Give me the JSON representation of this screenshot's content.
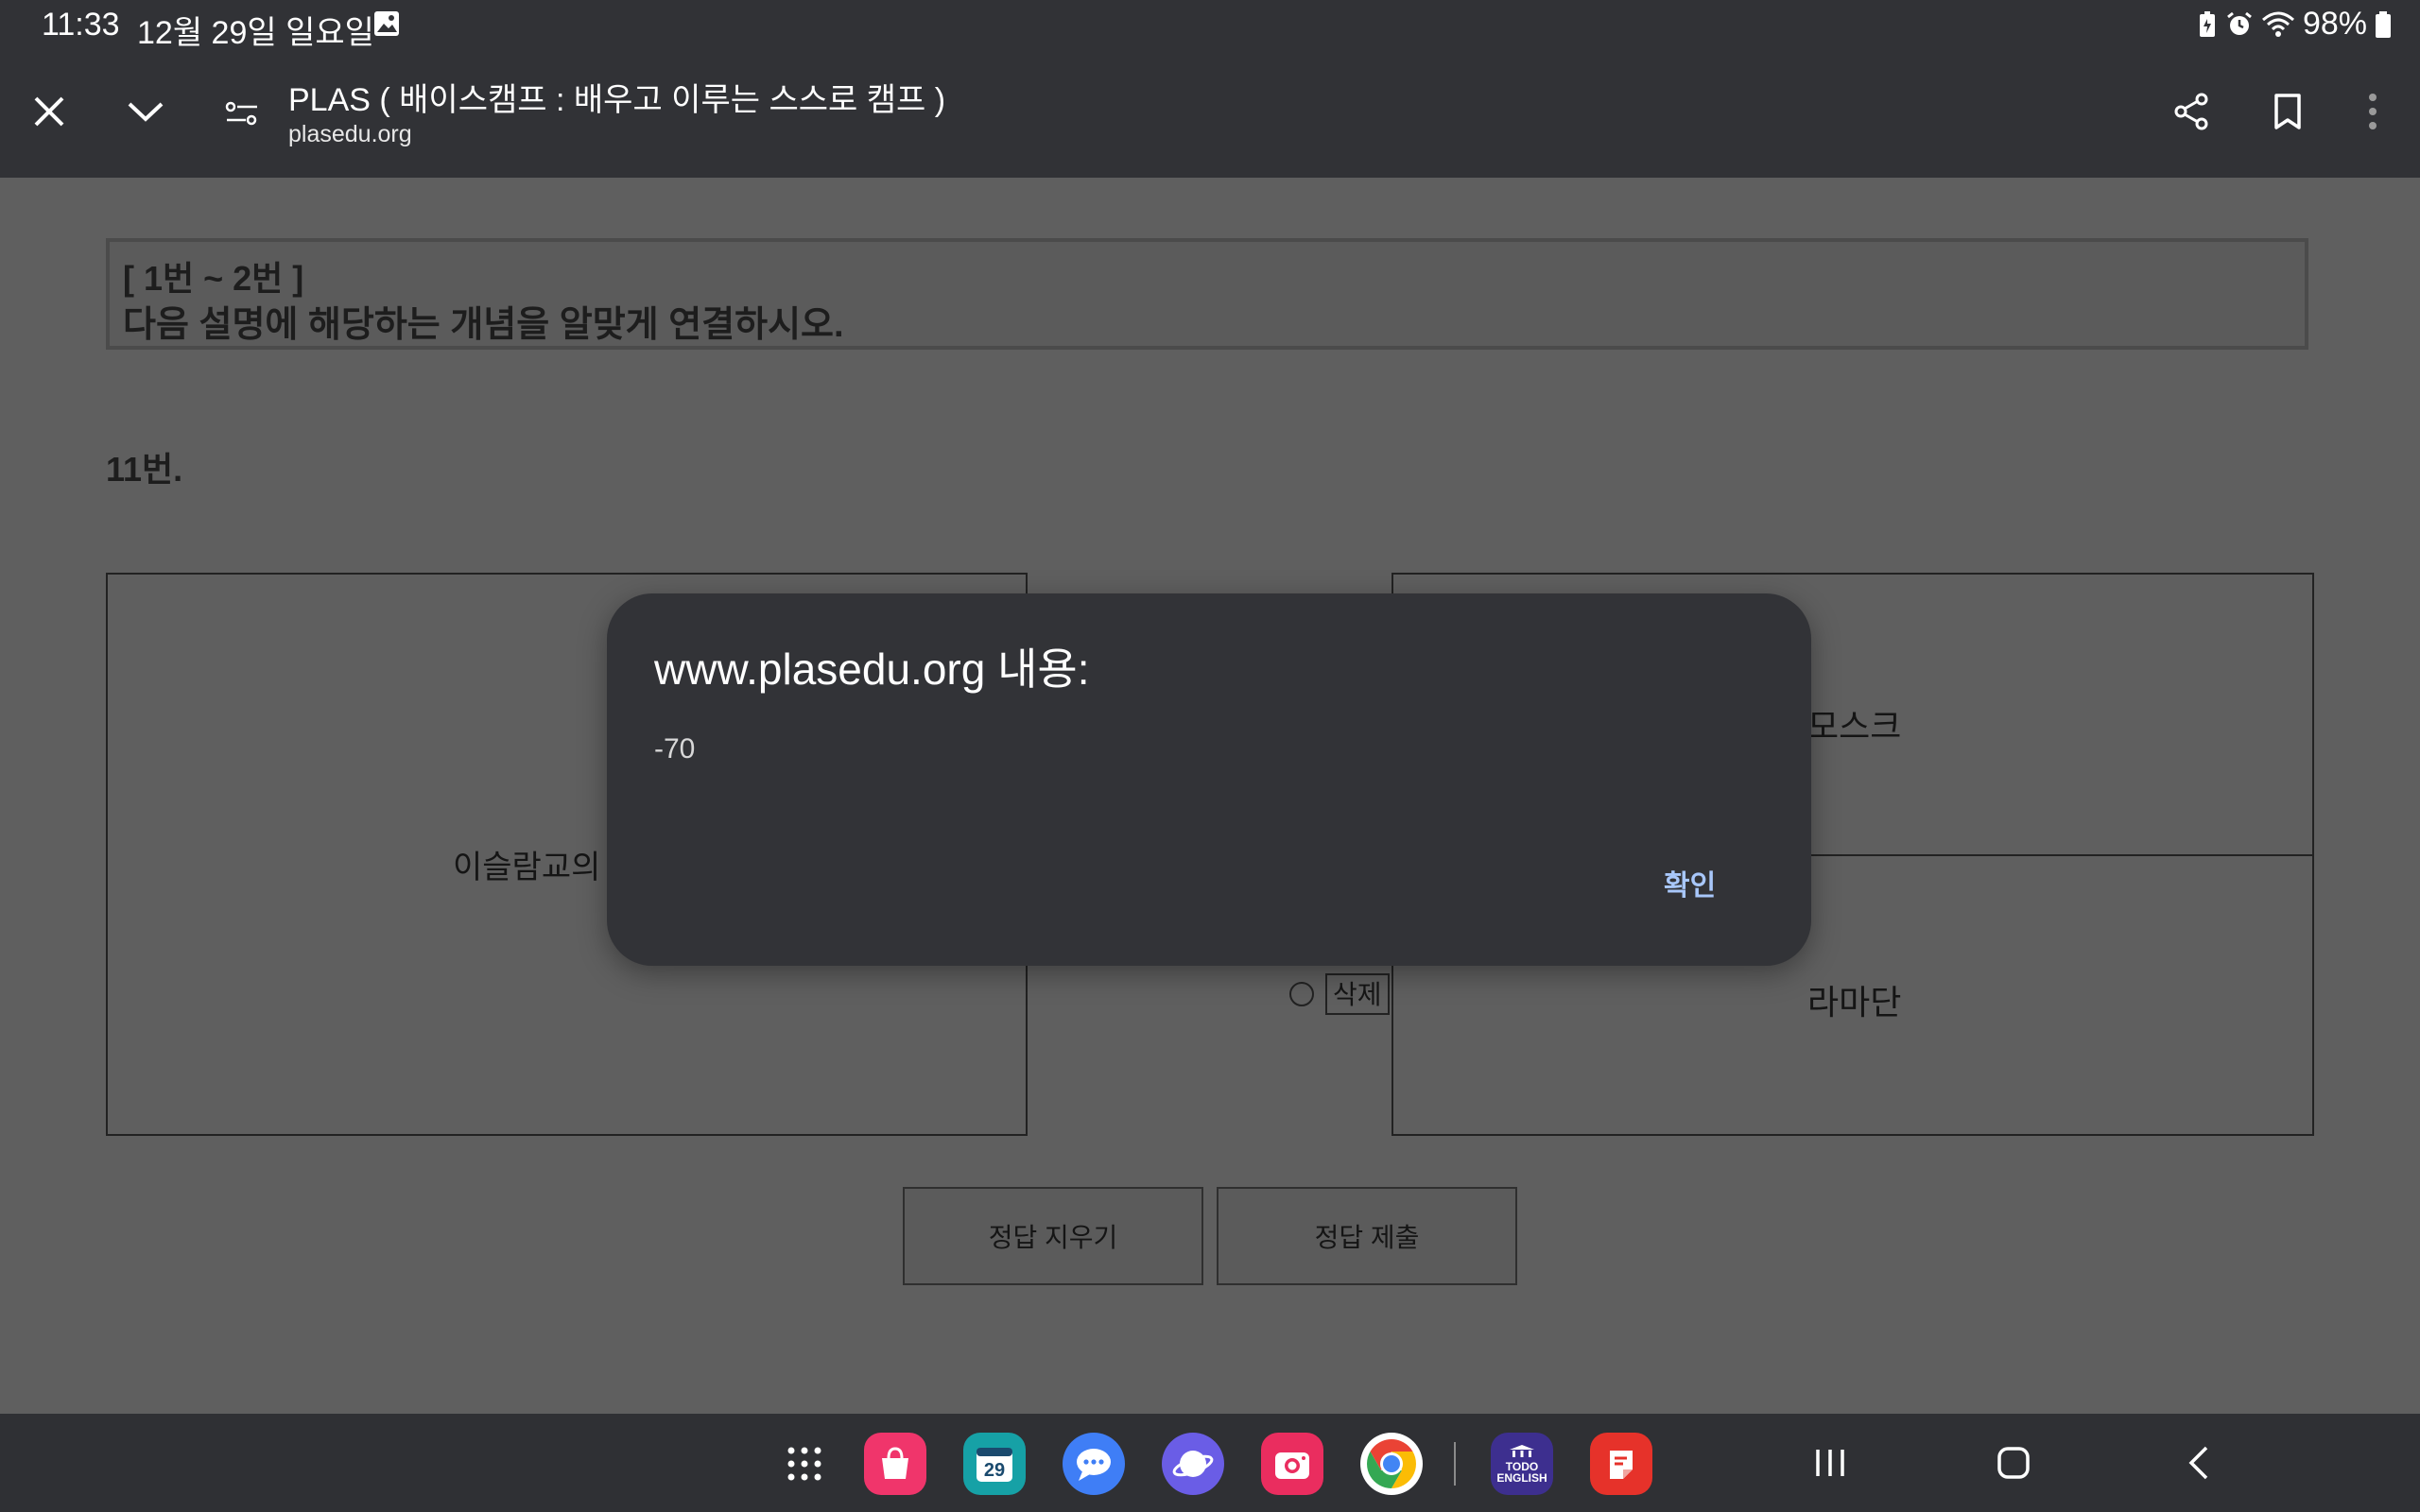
{
  "status_bar": {
    "time": "11:33",
    "date": "12월 29일 일요일",
    "battery": "98%"
  },
  "toolbar": {
    "page_title": "PLAS ( 배이스캠프 : 배우고 이루는 스스로 캠프 )",
    "url": "plasedu.org"
  },
  "page": {
    "instruction_range": "[ 1번 ~ 2번 ]",
    "instruction_text": "다음 설명에 해당하는 개념을 알맞게 연결하시오.",
    "question_number": "11번.",
    "left_item": "이슬람교의",
    "right_items": [
      "모스크",
      "라마단"
    ],
    "delete_label": "삭제",
    "clear_label": "정답 지우기",
    "submit_label": "정답 제출"
  },
  "dialog": {
    "title": "www.plasedu.org 내용:",
    "message": "-70",
    "ok_label": "확인"
  },
  "dock": {
    "todo_app_label": "TODO ENGLISH",
    "calendar_day": "29"
  },
  "colors": {
    "dialog_bg": "#323337",
    "dialog_ok": "#a8c7fa",
    "bar_bg": "#313236"
  }
}
